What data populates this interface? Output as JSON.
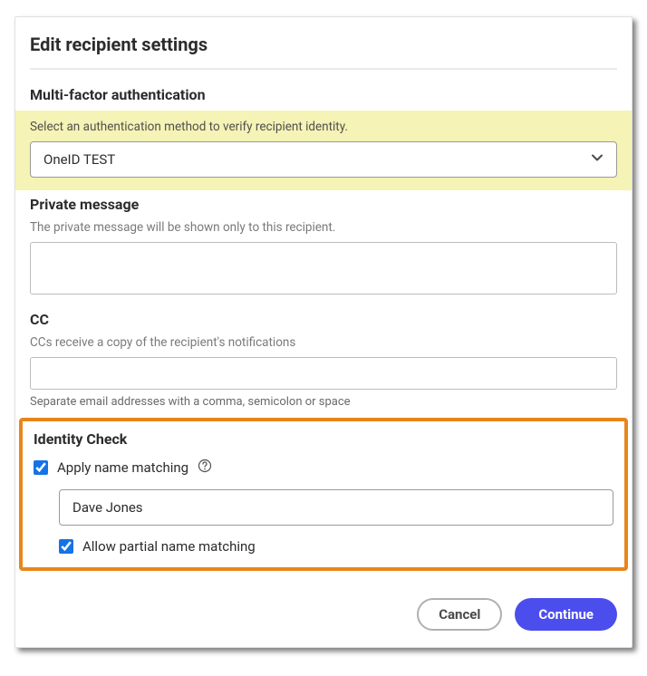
{
  "title": "Edit recipient settings",
  "mfa": {
    "heading": "Multi-factor authentication",
    "helper": "Select an authentication method to verify recipient identity.",
    "selected": "OneID TEST"
  },
  "private_message": {
    "heading": "Private message",
    "helper": "The private message will be shown only to this recipient.",
    "value": ""
  },
  "cc": {
    "heading": "CC",
    "helper": "CCs receive a copy of the recipient's notifications",
    "value": "",
    "hint_below": "Separate email addresses with a comma, semicolon or space"
  },
  "identity": {
    "heading": "Identity Check",
    "apply_label": "Apply name matching",
    "apply_checked": true,
    "name_value": "Dave Jones",
    "partial_label": "Allow partial name matching",
    "partial_checked": true
  },
  "buttons": {
    "cancel": "Cancel",
    "continue": "Continue"
  }
}
